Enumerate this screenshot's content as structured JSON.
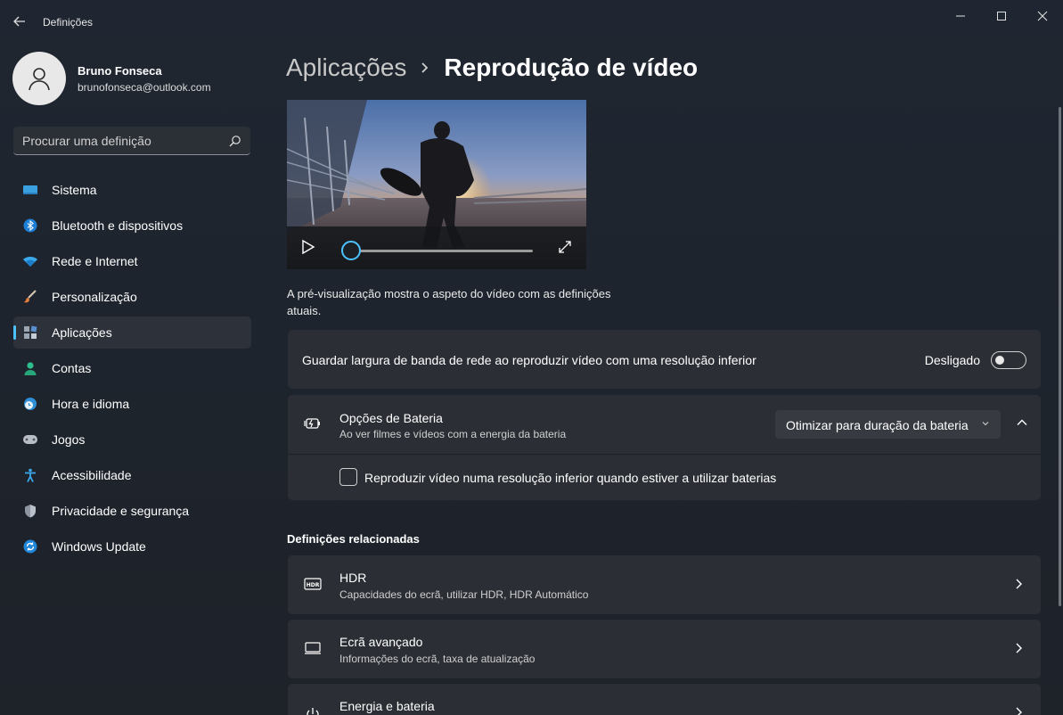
{
  "window": {
    "title": "Definições"
  },
  "profile": {
    "name": "Bruno Fonseca",
    "email": "brunofonseca@outlook.com"
  },
  "search": {
    "placeholder": "Procurar uma definição"
  },
  "sidebar": {
    "items": [
      {
        "label": "Sistema",
        "icon": "system-icon"
      },
      {
        "label": "Bluetooth e dispositivos",
        "icon": "bluetooth-icon"
      },
      {
        "label": "Rede e Internet",
        "icon": "wifi-icon"
      },
      {
        "label": "Personalização",
        "icon": "brush-icon"
      },
      {
        "label": "Aplicações",
        "icon": "apps-icon",
        "active": true
      },
      {
        "label": "Contas",
        "icon": "person-icon"
      },
      {
        "label": "Hora e idioma",
        "icon": "globe-clock-icon"
      },
      {
        "label": "Jogos",
        "icon": "gamepad-icon"
      },
      {
        "label": "Acessibilidade",
        "icon": "accessibility-icon"
      },
      {
        "label": "Privacidade e segurança",
        "icon": "shield-icon"
      },
      {
        "label": "Windows Update",
        "icon": "update-icon"
      }
    ]
  },
  "breadcrumb": {
    "parent": "Aplicações",
    "current": "Reprodução de vídeo"
  },
  "preview": {
    "description": "A pré-visualização mostra o aspeto do vídeo com as definições atuais.",
    "progress": 0
  },
  "bandwidth": {
    "label": "Guardar largura de banda de rede ao reproduzir vídeo com uma resolução inferior",
    "state": "Desligado"
  },
  "battery": {
    "title": "Opções de Bateria",
    "subtitle": "Ao ver filmes e vídeos com a energia da bateria",
    "selected": "Otimizar para duração da bateria",
    "checkbox_label": "Reproduzir vídeo numa resolução inferior quando estiver a utilizar baterias"
  },
  "related": {
    "heading": "Definições relacionadas",
    "items": [
      {
        "title": "HDR",
        "subtitle": "Capacidades do ecrã, utilizar HDR, HDR Automático",
        "icon": "hdr-icon"
      },
      {
        "title": "Ecrã avançado",
        "subtitle": "Informações do ecrã, taxa de atualização",
        "icon": "monitor-icon"
      },
      {
        "title": "Energia e bateria",
        "subtitle": "",
        "icon": "power-icon"
      }
    ]
  },
  "colors": {
    "accent": "#4cc2ff",
    "background": "#1f2631",
    "card": "#2b2e34"
  }
}
